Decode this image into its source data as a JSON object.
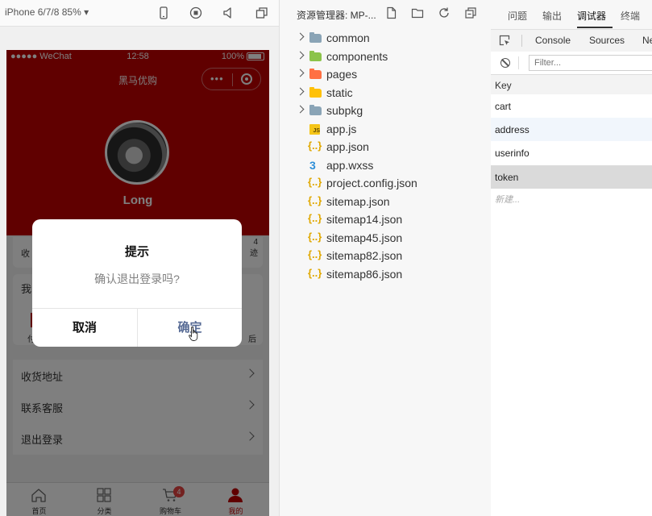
{
  "simulator": {
    "device": "iPhone 6/7/8 85% ▾",
    "status": {
      "carrier": "●●●●● WeChat",
      "time": "12:58",
      "battery": "100%"
    },
    "nav_title": "黑马优购",
    "capsule_dots": "•••",
    "user": {
      "nickname": "Long"
    },
    "stats": {
      "left": "收",
      "right_top": "4",
      "right_bottom": "迹"
    },
    "orders": {
      "title": "我",
      "label_left": "付",
      "label_right": "后"
    },
    "list": [
      {
        "label": "收货地址"
      },
      {
        "label": "联系客服"
      },
      {
        "label": "退出登录"
      }
    ],
    "tabs": [
      {
        "label": "首页"
      },
      {
        "label": "分类"
      },
      {
        "label": "购物车",
        "badge": "4"
      },
      {
        "label": "我的"
      }
    ],
    "active_color": "#c00000",
    "dialog": {
      "title": "提示",
      "message": "确认退出登录吗?",
      "cancel": "取消",
      "confirm": "确定"
    }
  },
  "explorer": {
    "title": "资源管理器: MP-...",
    "items": [
      {
        "label": "common",
        "kind": "folder",
        "color": "#8aa4b6"
      },
      {
        "label": "components",
        "kind": "folder",
        "color": "#8bc34a"
      },
      {
        "label": "pages",
        "kind": "folder",
        "color": "#ff7043"
      },
      {
        "label": "static",
        "kind": "folder",
        "color": "#ffc107"
      },
      {
        "label": "subpkg",
        "kind": "folder",
        "color": "#8aa4b6"
      },
      {
        "label": "app.js",
        "kind": "js"
      },
      {
        "label": "app.json",
        "kind": "json"
      },
      {
        "label": "app.wxss",
        "kind": "css"
      },
      {
        "label": "project.config.json",
        "kind": "json"
      },
      {
        "label": "sitemap.json",
        "kind": "json"
      },
      {
        "label": "sitemap14.json",
        "kind": "json"
      },
      {
        "label": "sitemap45.json",
        "kind": "json"
      },
      {
        "label": "sitemap82.json",
        "kind": "json"
      },
      {
        "label": "sitemap86.json",
        "kind": "json"
      }
    ]
  },
  "debugger": {
    "tabs": [
      "问题",
      "输出",
      "调试器",
      "终端"
    ],
    "active_tab": "调试器",
    "devtools_tabs": [
      "Console",
      "Sources",
      "Ne"
    ],
    "filter_placeholder": "Filter...",
    "key_header": "Key",
    "keys": [
      "cart",
      "address",
      "userinfo",
      "token"
    ],
    "selected_key": "token",
    "new_entry": "新建..."
  }
}
